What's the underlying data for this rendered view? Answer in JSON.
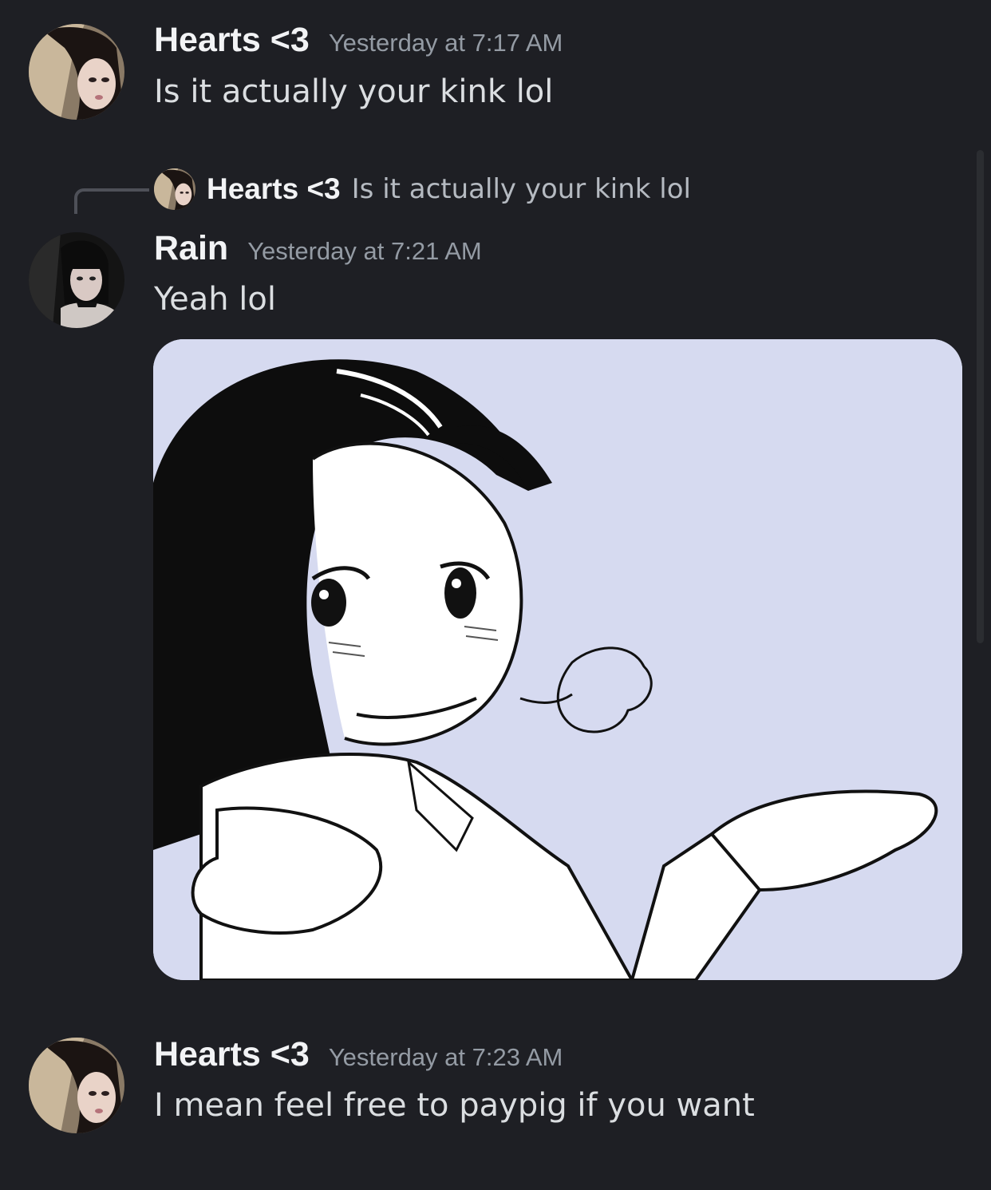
{
  "messages": [
    {
      "author": "Hearts <3",
      "timestamp": "Yesterday at 7:17 AM",
      "text": "Is it actually your kink lol"
    },
    {
      "author": "Rain",
      "timestamp": "Yesterday at 7:21 AM",
      "text": "Yeah lol",
      "reply": {
        "author": "Hearts <3",
        "text": "Is it actually your kink lol"
      },
      "attachment": {
        "type": "image",
        "description_icon": "shrug-manga-girl-image"
      }
    },
    {
      "author": "Hearts <3",
      "timestamp": "Yesterday at 7:23 AM",
      "text": "I mean feel free to paypig if you want"
    }
  ],
  "colors": {
    "background": "#1e1f24",
    "username": "#f2f3f5",
    "timestamp": "#949ba4",
    "message_text": "#dbdee1",
    "image_background": "#d6daf0"
  }
}
